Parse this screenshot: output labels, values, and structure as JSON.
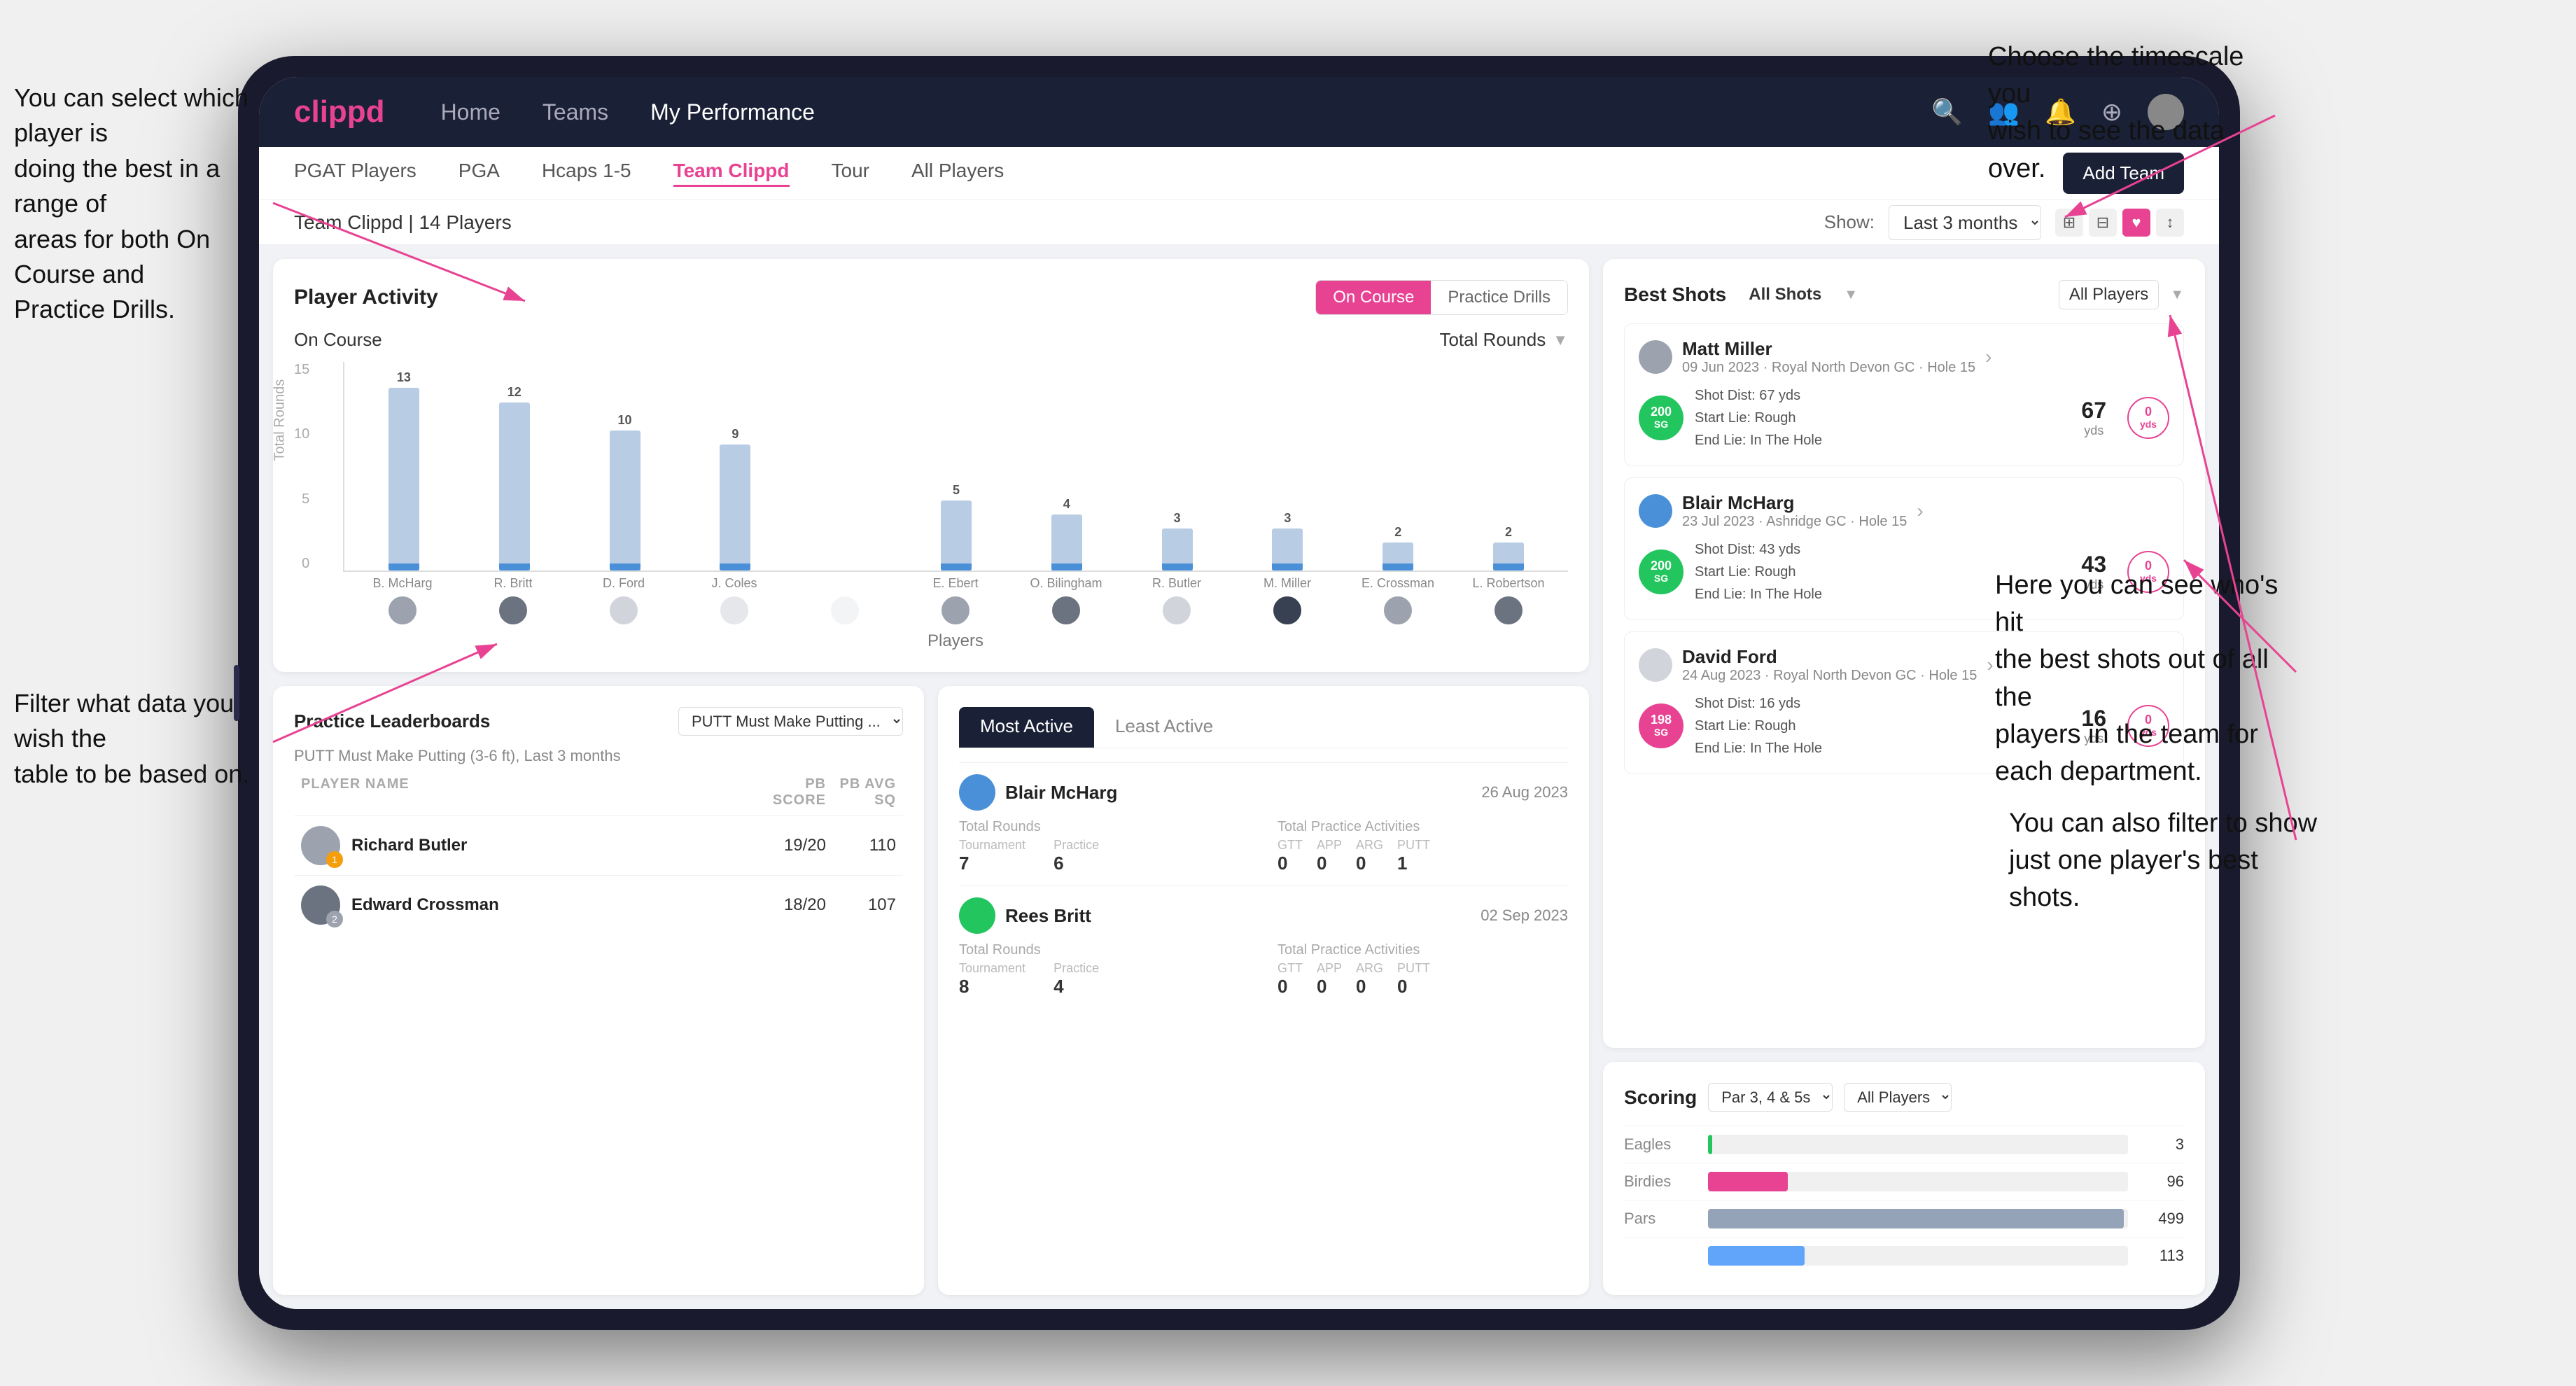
{
  "annotations": {
    "top_right": "Choose the timescale you\nwish to see the data over.",
    "left_top": "You can select which player is\ndoing the best in a range of\nareas for both On Course and\nPractice Drills.",
    "left_bottom": "Filter what data you wish the\ntable to be based on.",
    "right_mid": "Here you can see who's hit\nthe best shots out of all the\nplayers in the team for\neach department.",
    "right_bottom": "You can also filter to show\njust one player's best shots."
  },
  "nav": {
    "logo": "clippd",
    "links": [
      "Home",
      "Teams",
      "My Performance"
    ],
    "active_link": "My Performance"
  },
  "sub_nav": {
    "links": [
      "PGAT Players",
      "PGA",
      "Hcaps 1-5",
      "Team Clippd",
      "Tour",
      "All Players"
    ],
    "active_link": "Team Clippd",
    "add_button": "Add Team"
  },
  "team_header": {
    "title": "Team Clippd | 14 Players",
    "show_label": "Show:",
    "time_filter": "Last 3 months",
    "view_icons": [
      "⊞",
      "⊟",
      "♥",
      "↕"
    ]
  },
  "player_activity": {
    "title": "Player Activity",
    "tabs": [
      "On Course",
      "Practice Drills"
    ],
    "active_tab": "On Course",
    "section_label": "On Course",
    "chart_dropdown": "Total Rounds",
    "y_axis_label": "Total Rounds",
    "y_axis_values": [
      "15",
      "10",
      "5",
      "0"
    ],
    "bars": [
      {
        "player": "B. McHarg",
        "value": 13,
        "height_pct": 87
      },
      {
        "player": "R. Britt",
        "value": 12,
        "height_pct": 80
      },
      {
        "player": "D. Ford",
        "value": 10,
        "height_pct": 67
      },
      {
        "player": "J. Coles",
        "value": 9,
        "height_pct": 60
      },
      {
        "player": "",
        "value": null,
        "height_pct": 0
      },
      {
        "player": "E. Ebert",
        "value": 5,
        "height_pct": 33
      },
      {
        "player": "O. Billingham",
        "value": 4,
        "height_pct": 27
      },
      {
        "player": "R. Butler",
        "value": 3,
        "height_pct": 20
      },
      {
        "player": "M. Miller",
        "value": 3,
        "height_pct": 20
      },
      {
        "player": "E. Crossman",
        "value": 2,
        "height_pct": 13
      },
      {
        "player": "L. Robertson",
        "value": 2,
        "height_pct": 13
      }
    ],
    "x_title": "Players"
  },
  "best_shots": {
    "title": "Best Shots",
    "tabs": [
      "All Shots",
      "All Players"
    ],
    "players": [
      {
        "name": "Matt Miller",
        "date": "09 Jun 2023 · Royal North Devon GC",
        "hole": "Hole 15",
        "badge_color": "green",
        "badge_num": "200",
        "badge_suffix": "SG",
        "shot_dist": "Shot Dist: 67 yds",
        "start_lie": "Start Lie: Rough",
        "end_lie": "End Lie: In The Hole",
        "stat1_val": "67",
        "stat1_unit": "yds",
        "stat2_val": "0",
        "stat2_unit": "yds"
      },
      {
        "name": "Blair McHarg",
        "date": "23 Jul 2023 · Ashridge GC",
        "hole": "Hole 15",
        "badge_color": "green",
        "badge_num": "200",
        "badge_suffix": "SG",
        "shot_dist": "Shot Dist: 43 yds",
        "start_lie": "Start Lie: Rough",
        "end_lie": "End Lie: In The Hole",
        "stat1_val": "43",
        "stat1_unit": "yds",
        "stat2_val": "0",
        "stat2_unit": "yds"
      },
      {
        "name": "David Ford",
        "date": "24 Aug 2023 · Royal North Devon GC",
        "hole": "Hole 15",
        "badge_color": "pink",
        "badge_num": "198",
        "badge_suffix": "SG",
        "shot_dist": "Shot Dist: 16 yds",
        "start_lie": "Start Lie: Rough",
        "end_lie": "End Lie: In The Hole",
        "stat1_val": "16",
        "stat1_unit": "yds",
        "stat2_val": "0",
        "stat2_unit": "yds"
      }
    ]
  },
  "practice_leaderboards": {
    "title": "Practice Leaderboards",
    "dropdown": "PUTT Must Make Putting ...",
    "subtitle": "PUTT Must Make Putting (3-6 ft), Last 3 months",
    "columns": [
      "PLAYER NAME",
      "PB SCORE",
      "PB AVG SQ"
    ],
    "rows": [
      {
        "rank": 1,
        "name": "Richard Butler",
        "pb_score": "19/20",
        "pb_avg": "110",
        "badge": "gold",
        "badge_num": "1"
      },
      {
        "rank": 2,
        "name": "Edward Crossman",
        "pb_score": "18/20",
        "pb_avg": "107",
        "badge": "silver",
        "badge_num": "2"
      }
    ]
  },
  "most_active": {
    "tabs": [
      "Most Active",
      "Least Active"
    ],
    "active_tab": "Most Active",
    "players": [
      {
        "name": "Blair McHarg",
        "date": "26 Aug 2023",
        "total_rounds_label": "Total Rounds",
        "tournament": "7",
        "practice": "6",
        "total_practice_label": "Total Practice Activities",
        "gtt": "0",
        "app": "0",
        "arg": "0",
        "putt": "1"
      },
      {
        "name": "Rees Britt",
        "date": "02 Sep 2023",
        "total_rounds_label": "Total Rounds",
        "tournament": "8",
        "practice": "4",
        "total_practice_label": "Total Practice Activities",
        "gtt": "0",
        "app": "0",
        "arg": "0",
        "putt": "0"
      }
    ]
  },
  "scoring": {
    "title": "Scoring",
    "dropdown1": "Par 3, 4 & 5s",
    "dropdown2": "All Players",
    "rows": [
      {
        "label": "Eagles",
        "value": 3,
        "max": 500,
        "color": "#22c55e",
        "pct": 1
      },
      {
        "label": "Birdies",
        "value": 96,
        "max": 500,
        "color": "#e84393",
        "pct": 19
      },
      {
        "label": "Pars",
        "value": 499,
        "max": 500,
        "color": "#94a3b8",
        "pct": 99
      },
      {
        "label": "",
        "value": 113,
        "max": 500,
        "color": "#60a5fa",
        "pct": 23
      }
    ]
  }
}
